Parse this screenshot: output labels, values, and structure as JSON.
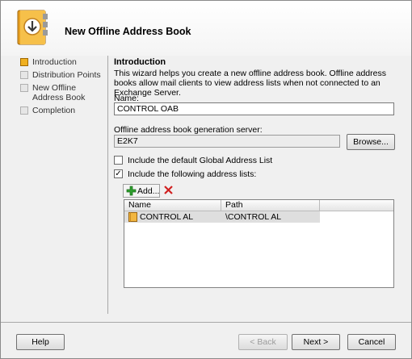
{
  "header": {
    "title": "New Offline Address Book",
    "icon": "address-book-icon"
  },
  "nav": [
    {
      "label": "Introduction",
      "active": true
    },
    {
      "label": "Distribution Points",
      "active": false
    },
    {
      "label": "New Offline Address Book",
      "active": false
    },
    {
      "label": "Completion",
      "active": false
    }
  ],
  "intro": {
    "title": "Introduction",
    "description": "This wizard helps you create a new offline address book. Offline address books allow mail clients to view address lists when not connected to an Exchange Server."
  },
  "name_field": {
    "label": "Name:",
    "value": "CONTROL OAB"
  },
  "server_field": {
    "label": "Offline address book generation server:",
    "value": "E2K7",
    "browse_label": "Browse..."
  },
  "options": {
    "include_default_gal": {
      "label": "Include the default Global Address List",
      "checked": false
    },
    "include_following": {
      "label": "Include the following address lists:",
      "checked": true
    }
  },
  "toolbar": {
    "add_label": "Add...",
    "add_icon": "add-icon",
    "remove_icon": "remove-icon"
  },
  "grid": {
    "columns": [
      "Name",
      "Path"
    ],
    "rows": [
      {
        "name": "CONTROL AL",
        "path": "\\CONTROL AL",
        "icon": "address-list-icon"
      }
    ]
  },
  "footer": {
    "help": "Help",
    "back": "< Back",
    "next": "Next >",
    "cancel": "Cancel"
  },
  "colors": {
    "accent": "#f0b020",
    "background": "#f0f0f0"
  }
}
